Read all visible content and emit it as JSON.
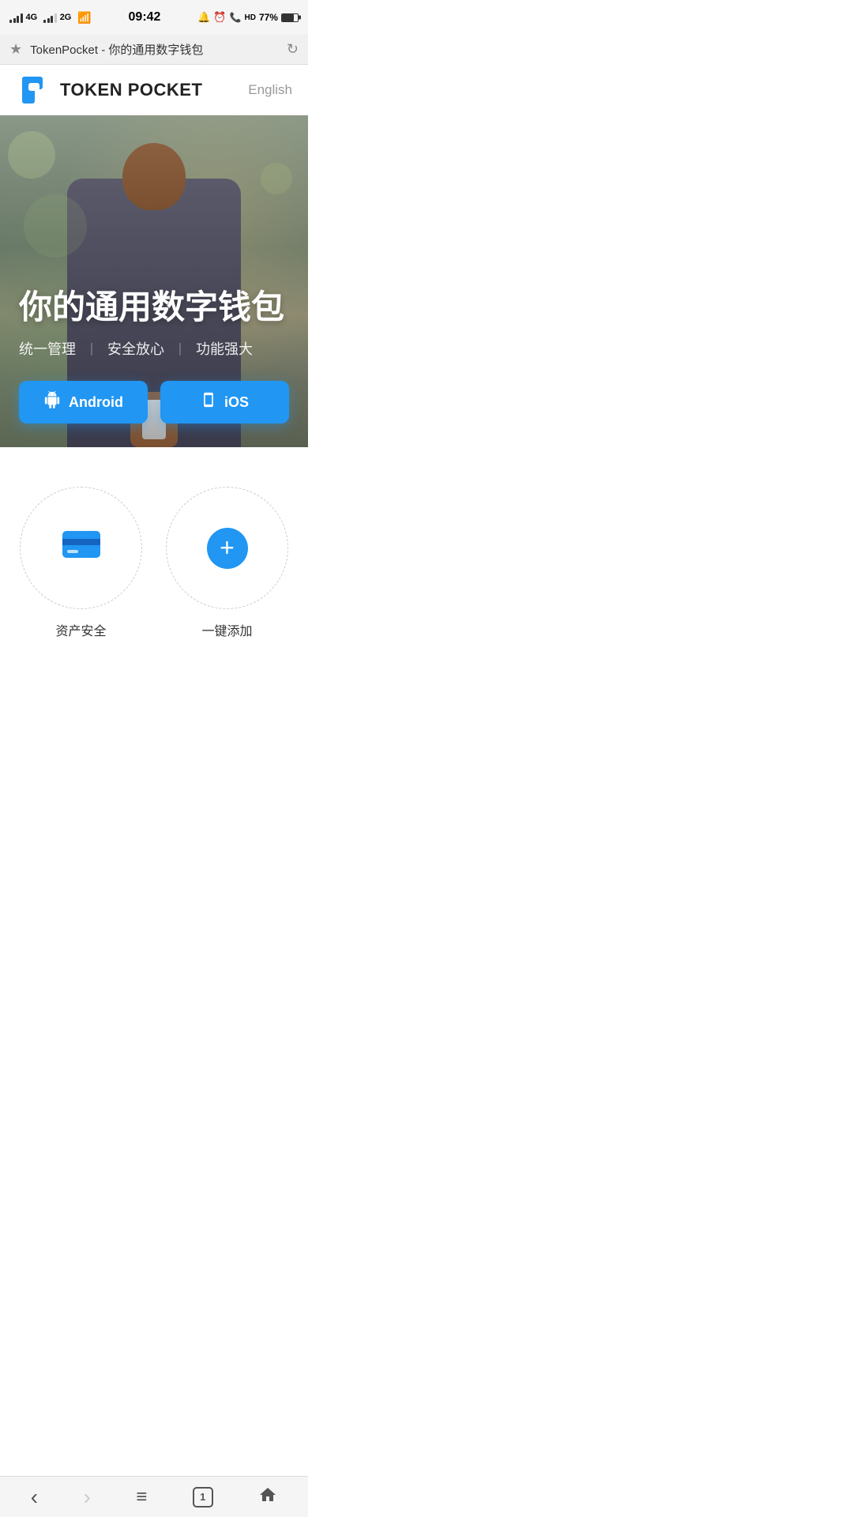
{
  "statusBar": {
    "time": "09:42",
    "battery": "77%",
    "signal": "4G",
    "signal2": "2G"
  },
  "browserBar": {
    "url": "TokenPocket - 你的通用数字钱包",
    "starLabel": "★",
    "reloadLabel": "↻"
  },
  "header": {
    "logoText": "TOKEN POCKET",
    "langSwitch": "English"
  },
  "hero": {
    "title": "你的通用数字钱包",
    "subtitle1": "统一管理",
    "subtitle2": "安全放心",
    "subtitle3": "功能强大",
    "androidBtn": "Android",
    "iosBtn": "iOS"
  },
  "features": {
    "card1": {
      "label": "资产安全"
    },
    "card2": {
      "label": "一键添加"
    }
  },
  "bottomNav": {
    "back": "‹",
    "forward": "›",
    "menu": "≡",
    "tabCount": "1",
    "home": "⌂"
  }
}
